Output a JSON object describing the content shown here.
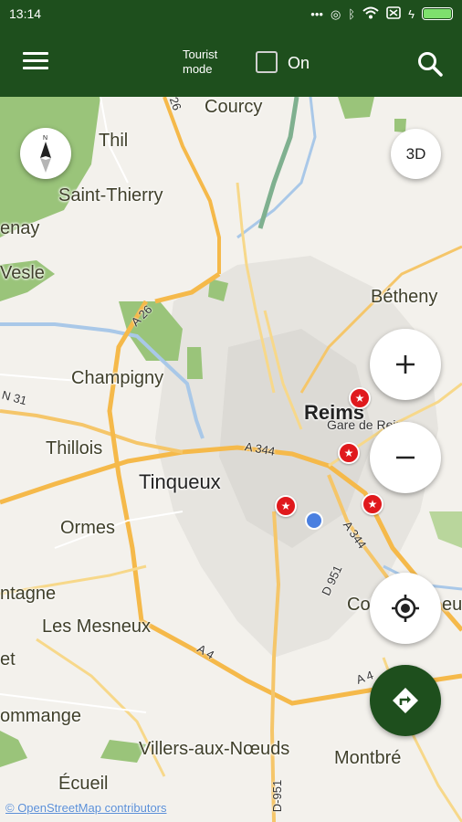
{
  "status": {
    "time": "13:14",
    "icons": [
      "more-dots-icon",
      "hotspot-icon",
      "bluetooth-icon",
      "wifi-icon",
      "sim-off-icon",
      "charging-icon",
      "battery-icon"
    ],
    "battery_level": 1.0
  },
  "toolbar": {
    "tourist_mode_label": "Tourist mode",
    "toggle_label": "On",
    "tourist_mode_checked": false
  },
  "map": {
    "places": {
      "courcy": "Courcy",
      "thil": "Thil",
      "saint_thierry": "Saint-Thierry",
      "venay": "enay",
      "vesle": "Vesle",
      "betheny": "Bétheny",
      "champigny": "Champigny",
      "reims": "Reims",
      "gare": "Gare de Reims",
      "thillois": "Thillois",
      "tinqueux": "Tinqueux",
      "ormes": "Ormes",
      "ntagne": "ntagne",
      "les_mesneux": "Les Mesneux",
      "et": "et",
      "cormontreuil_a": "Co",
      "cormontreuil_b": "eu",
      "ommange": "ommange",
      "villers": "Villers-aux-Nœuds",
      "montbre": "Montbré",
      "ecueil": "Écueil"
    },
    "roads": {
      "r26": "26",
      "a26": "A 26",
      "n31": "N 31",
      "a344": "A 344",
      "a344b": "A 344",
      "d951": "D 951",
      "a4": "A 4",
      "a4b": "A 4",
      "d951b": "D-951"
    }
  },
  "controls": {
    "btn_3d": "3D",
    "compass_n": "N"
  },
  "attribution": "© OpenStreetMap contributors",
  "colors": {
    "primary": "#1e4f1d",
    "map_bg": "#f3f1ec",
    "poi": "#e0191d",
    "park": "#9ac47a",
    "water": "#a9c8e8",
    "highway": "#f5b94a"
  }
}
